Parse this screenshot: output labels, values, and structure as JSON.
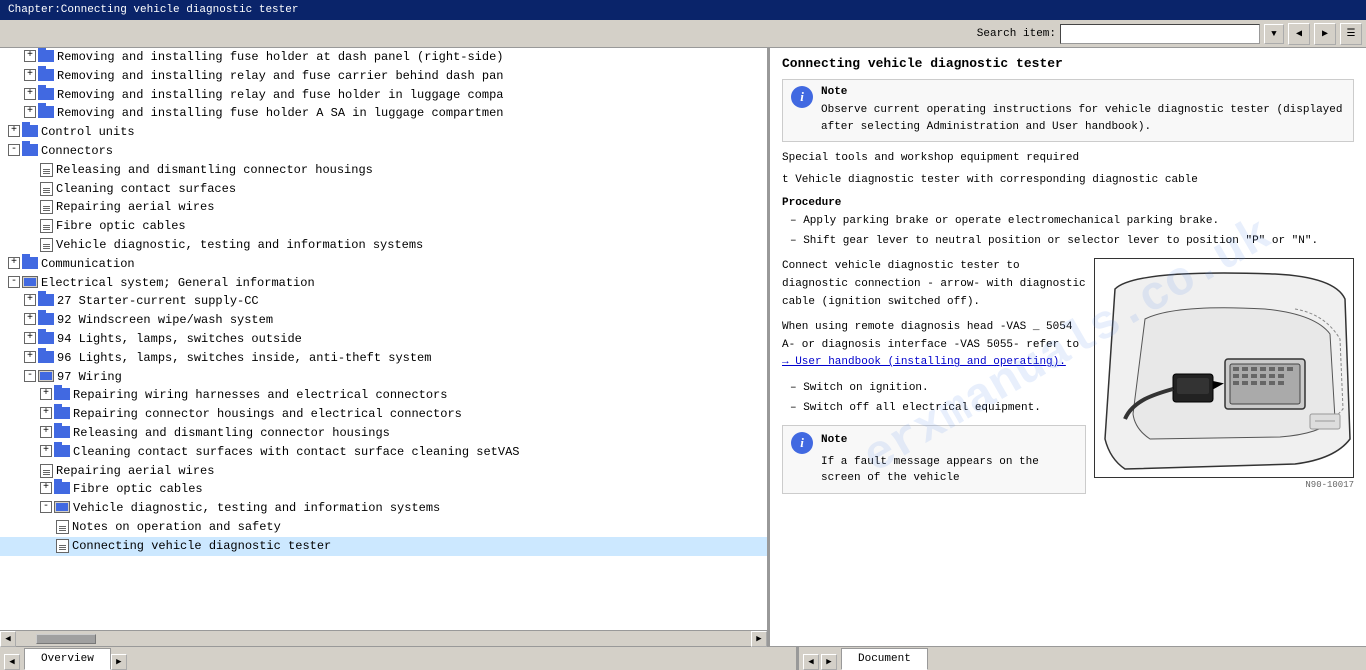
{
  "titleBar": {
    "text": "Chapter:Connecting vehicle diagnostic tester"
  },
  "toolbar": {
    "searchLabel": "Search item:",
    "searchPlaceholder": ""
  },
  "treeItems": [
    {
      "id": 1,
      "indent": 2,
      "type": "folder-expand",
      "expanded": true,
      "text": "Removing and installing fuse holder at dash panel (right-side)"
    },
    {
      "id": 2,
      "indent": 2,
      "type": "folder-expand",
      "expanded": false,
      "text": "Removing and installing relay and fuse carrier behind dash pan"
    },
    {
      "id": 3,
      "indent": 2,
      "type": "folder-expand",
      "expanded": false,
      "text": "Removing and installing relay and fuse holder in luggage comp"
    },
    {
      "id": 4,
      "indent": 2,
      "type": "folder-expand",
      "expanded": false,
      "text": "Removing and installing fuse holder A SA in luggage compartmen"
    },
    {
      "id": 5,
      "indent": 1,
      "type": "folder-expand",
      "expanded": false,
      "text": "Control units"
    },
    {
      "id": 6,
      "indent": 1,
      "type": "folder-expand",
      "expanded": true,
      "text": "Connectors"
    },
    {
      "id": 7,
      "indent": 2,
      "type": "doc",
      "text": "Releasing and dismantling connector housings"
    },
    {
      "id": 8,
      "indent": 2,
      "type": "doc",
      "text": "Cleaning contact surfaces"
    },
    {
      "id": 9,
      "indent": 2,
      "type": "doc",
      "text": "Repairing aerial wires"
    },
    {
      "id": 10,
      "indent": 2,
      "type": "doc",
      "text": "Fibre optic cables"
    },
    {
      "id": 11,
      "indent": 2,
      "type": "doc",
      "text": "Vehicle diagnostic, testing and information systems"
    },
    {
      "id": 12,
      "indent": 1,
      "type": "folder-expand",
      "expanded": false,
      "text": "Communication"
    },
    {
      "id": 13,
      "indent": 1,
      "type": "folder-expand",
      "expanded": false,
      "text": "Electrical system; General information"
    },
    {
      "id": 14,
      "indent": 1,
      "type": "folder-expand-open",
      "expanded": true,
      "text": ""
    },
    {
      "id": 15,
      "indent": 2,
      "type": "folder-expand",
      "expanded": false,
      "text": "27 Starter-current supply-CC"
    },
    {
      "id": 16,
      "indent": 2,
      "type": "folder-expand",
      "expanded": false,
      "text": "92 Windscreen wipe/wash system"
    },
    {
      "id": 17,
      "indent": 2,
      "type": "folder-expand",
      "expanded": false,
      "text": "94 Lights, lamps, switches outside"
    },
    {
      "id": 18,
      "indent": 2,
      "type": "folder-expand",
      "expanded": false,
      "text": "96 Lights, lamps, switches inside, anti-theft system"
    },
    {
      "id": 19,
      "indent": 2,
      "type": "folder-expand-open",
      "expanded": true,
      "text": "97 Wiring"
    },
    {
      "id": 20,
      "indent": 3,
      "type": "folder-expand",
      "expanded": false,
      "text": "Repairing wiring harnesses and electrical connectors"
    },
    {
      "id": 21,
      "indent": 3,
      "type": "folder-expand",
      "expanded": false,
      "text": "Repairing connector housings and electrical connectors"
    },
    {
      "id": 22,
      "indent": 3,
      "type": "folder-expand",
      "expanded": false,
      "text": "Releasing and dismantling connector housings"
    },
    {
      "id": 23,
      "indent": 3,
      "type": "folder-expand",
      "expanded": false,
      "text": "Cleaning contact surfaces with contact surface cleaning setVAS"
    },
    {
      "id": 24,
      "indent": 3,
      "type": "doc",
      "text": "Repairing aerial wires"
    },
    {
      "id": 25,
      "indent": 3,
      "type": "folder-expand",
      "expanded": false,
      "text": "Fibre optic cables"
    },
    {
      "id": 26,
      "indent": 3,
      "type": "folder-expand-open",
      "expanded": true,
      "text": "Vehicle diagnostic, testing and information systems"
    },
    {
      "id": 27,
      "indent": 4,
      "type": "doc",
      "text": "Notes on operation and safety"
    },
    {
      "id": 28,
      "indent": 4,
      "type": "doc",
      "text": "Connecting vehicle diagnostic tester"
    }
  ],
  "rightPanel": {
    "title": "Connecting vehicle diagnostic tester",
    "noteLabel": "Note",
    "noteText": "Observe current operating instructions for vehicle diagnostic tester (displayed after selecting Administration and User handbook).",
    "specialTools": "Special tools and workshop equipment required",
    "toolItem": "t  Vehicle diagnostic tester with corresponding diagnostic cable",
    "procedureLabel": "Procedure",
    "steps": [
      "Apply parking brake or operate electromechanical parking brake.",
      "Shift gear lever to neutral position or selector lever to position \"P\" or \"N\"."
    ],
    "connectText": "Connect vehicle diagnostic tester to diagnostic connection - arrow- with diagnostic cable (ignition switched off).",
    "remoteText": "When using remote diagnosis head -VAS _ 5054 A- or diagnosis interface -VAS 5055- refer to",
    "linkText": "→ User handbook (installing and operating).",
    "switchOnText": "Switch on ignition.",
    "switchOffText": "Switch off all electrical equipment.",
    "note2Label": "Note",
    "note2Text": "If a fault message appears on the screen of the vehicle",
    "diagramLabel": "N90-10017"
  },
  "statusBar": {
    "leftTab": "Overview",
    "rightTab": "Document"
  },
  "watermark": "erxmanuals.co.uk"
}
